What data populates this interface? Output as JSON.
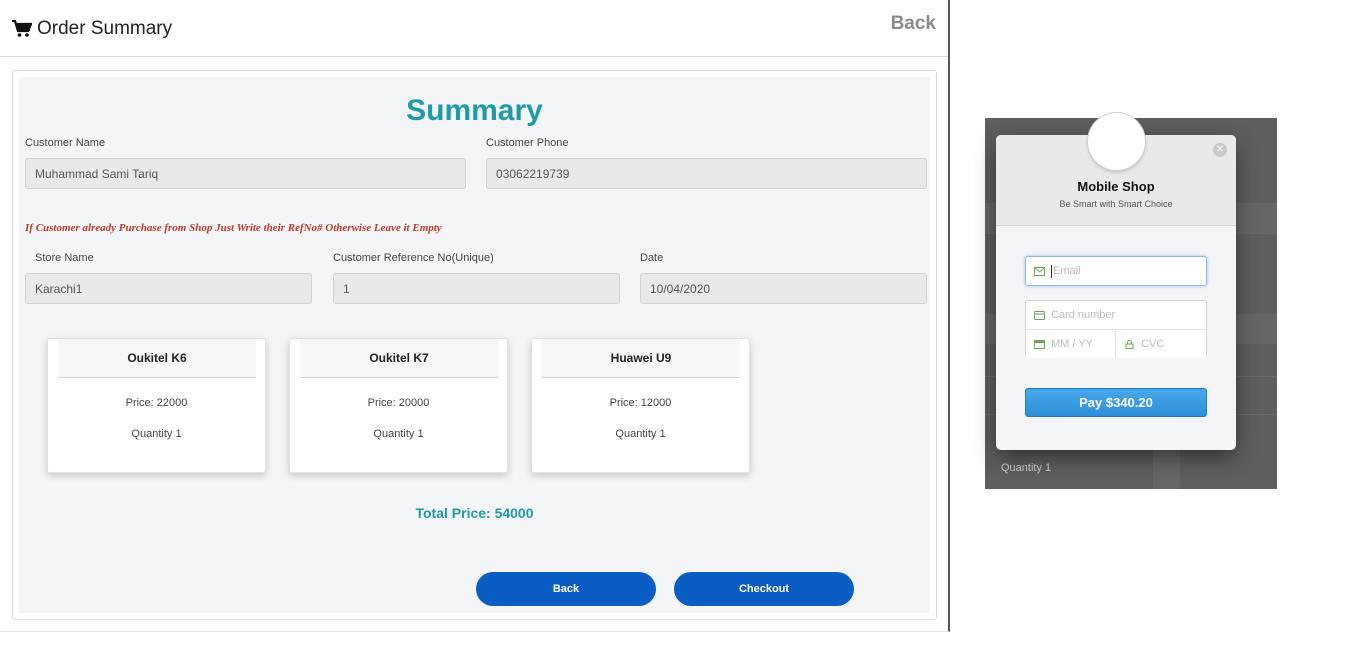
{
  "header": {
    "title": "Order Summary",
    "back_label": "Back"
  },
  "summary": {
    "title": "Summary",
    "customer_name_label": "Customer Name",
    "customer_name_value": "Muhammad Sami Tariq",
    "customer_phone_label": "Customer Phone",
    "customer_phone_value": "03062219739",
    "notice": "If Customer already Purchase from Shop Just Write their RefNo# Otherwise Leave it Empty",
    "store_name_label": "Store Name",
    "store_name_value": "Karachi1",
    "customer_ref_label": "Customer Reference No(Unique)",
    "customer_ref_value": "1",
    "date_label": "Date",
    "date_value": "10/04/2020"
  },
  "products": [
    {
      "name": "Oukitel K6",
      "price": "Price: 22000",
      "quantity": "Quantity 1"
    },
    {
      "name": "Oukitel K7",
      "price": "Price: 20000",
      "quantity": "Quantity 1"
    },
    {
      "name": "Huawei U9",
      "price": "Price: 12000",
      "quantity": "Quantity 1"
    }
  ],
  "total": "Total Price: 54000",
  "buttons": {
    "back": "Back",
    "checkout": "Checkout"
  },
  "checkout": {
    "shop_name": "Mobile Shop",
    "tagline": "Be Smart with Smart Choice",
    "email_placeholder": "Email",
    "card_placeholder": "Card number",
    "expiry_placeholder": "MM / YY",
    "cvc_placeholder": "CVC",
    "pay_label": "Pay $340.20",
    "background_text": "Quantity 1"
  },
  "colors": {
    "accent_teal": "#1e9aa8",
    "button_blue": "#0a5dc2",
    "notice_red": "#c0392b",
    "pay_blue": "#2d8fd9"
  },
  "icons": [
    "shopping-cart-icon",
    "close-icon",
    "email-icon",
    "card-icon",
    "calendar-icon",
    "lock-icon"
  ]
}
